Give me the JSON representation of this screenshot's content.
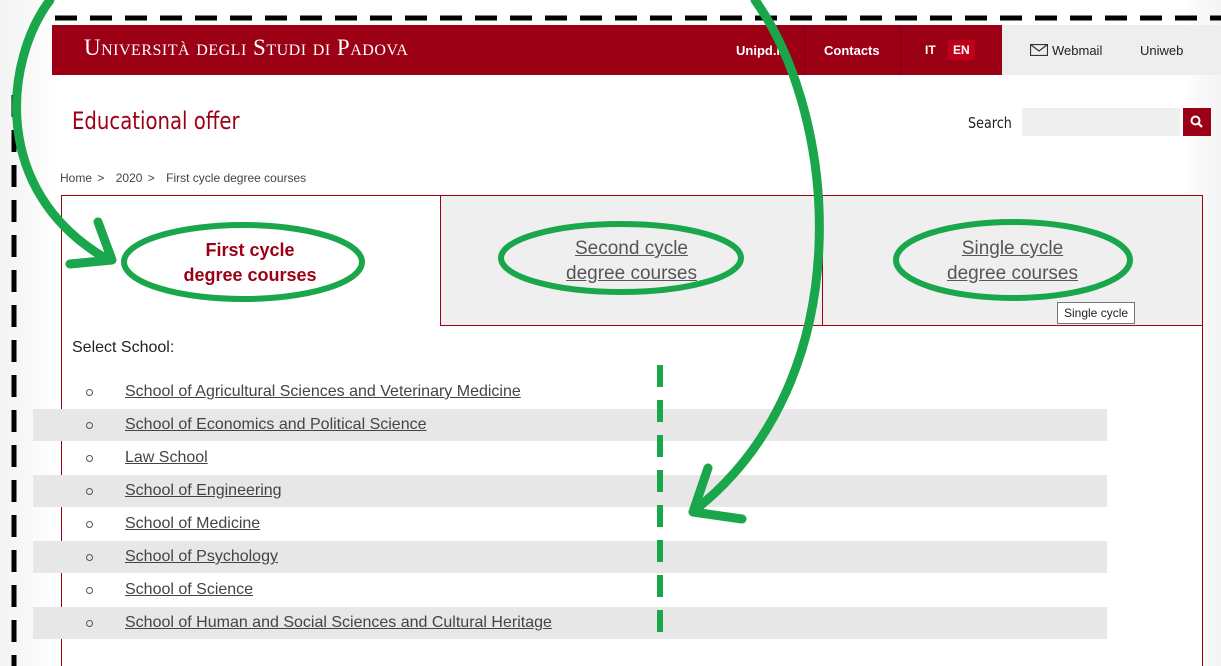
{
  "header": {
    "brand": "Università degli Studi di Padova",
    "links": {
      "unipd": "Unipd.it",
      "contacts": "Contacts",
      "lang_it": "IT",
      "lang_en": "EN",
      "webmail": "Webmail",
      "uniweb": "Uniweb"
    },
    "brand_color": "#9b0014"
  },
  "page": {
    "title": "Educational offer",
    "search_label": "Search",
    "search_value": ""
  },
  "breadcrumb": {
    "home": "Home",
    "year": "2020",
    "current": "First cycle degree courses",
    "separator": ">"
  },
  "tabs": [
    {
      "line1": "First cycle",
      "line2": "degree courses",
      "active": true
    },
    {
      "line1": "Second cycle",
      "line2": "degree courses",
      "active": false
    },
    {
      "line1": "Single cycle",
      "line2": "degree courses",
      "active": false
    }
  ],
  "tooltip": "Single cycle",
  "select_label": "Select School:",
  "schools": [
    "School of Agricultural Sciences and Veterinary Medicine",
    "School of Economics and Political Science",
    "Law School",
    "School of Engineering",
    "School of Medicine",
    "School of Psychology",
    "School of Science",
    "School of Human and Social Sciences and Cultural Heritage"
  ],
  "annotation_color": "#1aa64b"
}
